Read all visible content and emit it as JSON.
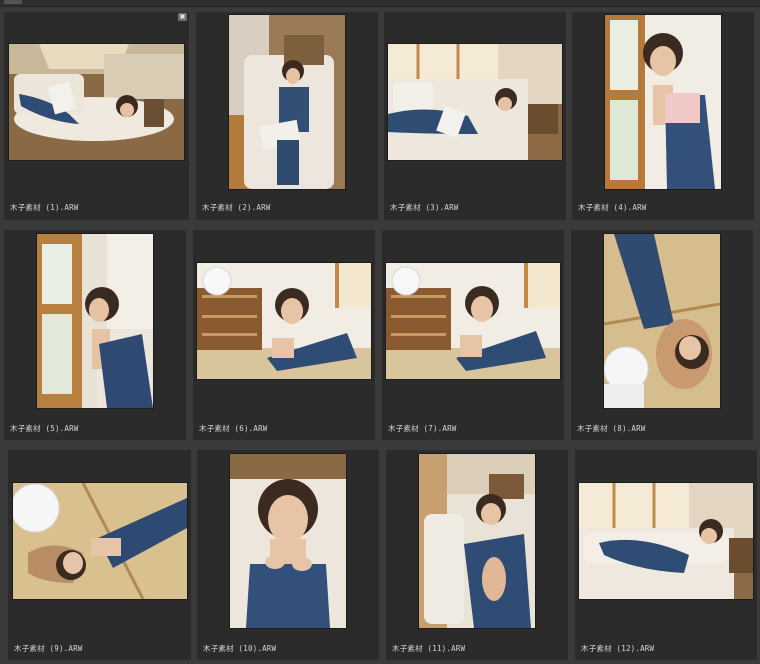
{
  "browser": {
    "badge_icon": "image-type-badge",
    "items": [
      {
        "filename": "木子素材 (1).ARW",
        "orientation": "landscape"
      },
      {
        "filename": "木子素材 (2).ARW",
        "orientation": "portrait"
      },
      {
        "filename": "木子素材 (3).ARW",
        "orientation": "landscape"
      },
      {
        "filename": "木子素材 (4).ARW",
        "orientation": "portrait"
      },
      {
        "filename": "木子素材 (5).ARW",
        "orientation": "portrait"
      },
      {
        "filename": "木子素材 (6).ARW",
        "orientation": "landscape"
      },
      {
        "filename": "木子素材 (7).ARW",
        "orientation": "landscape"
      },
      {
        "filename": "木子素材 (8).ARW",
        "orientation": "portrait"
      },
      {
        "filename": "木子素材 (9).ARW",
        "orientation": "landscape"
      },
      {
        "filename": "木子素材 (10).ARW",
        "orientation": "portrait"
      },
      {
        "filename": "木子素材 (11).ARW",
        "orientation": "portrait"
      },
      {
        "filename": "木子素材 (12).ARW",
        "orientation": "landscape"
      }
    ]
  },
  "colors": {
    "background": "#3a3a3a",
    "cell": "#2b2b2b",
    "caption_text": "#d6d6d6"
  }
}
